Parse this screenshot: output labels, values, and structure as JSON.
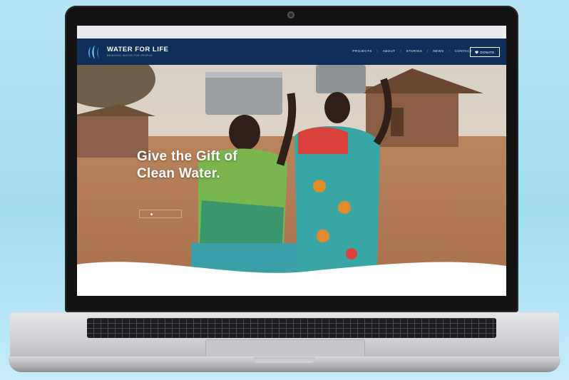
{
  "site": {
    "brand": "WATER FOR LIFE",
    "tagline": "BRINGING WATER FOR PEOPLE",
    "nav": [
      "PROJECTS",
      "ABOUT",
      "STORIES",
      "NEWS",
      "CONTACT"
    ],
    "donate_label": "DONATE",
    "hero_title_line1": "Give the Gift of",
    "hero_title_line2": "Clean Water."
  },
  "colors": {
    "navbar": "#0e2f5a",
    "background": "#a9def3",
    "logo_accent": "#4aa8e0"
  },
  "icons": {
    "logo": "water-drops-icon",
    "donate": "heart-icon",
    "camera": "camera-icon"
  }
}
